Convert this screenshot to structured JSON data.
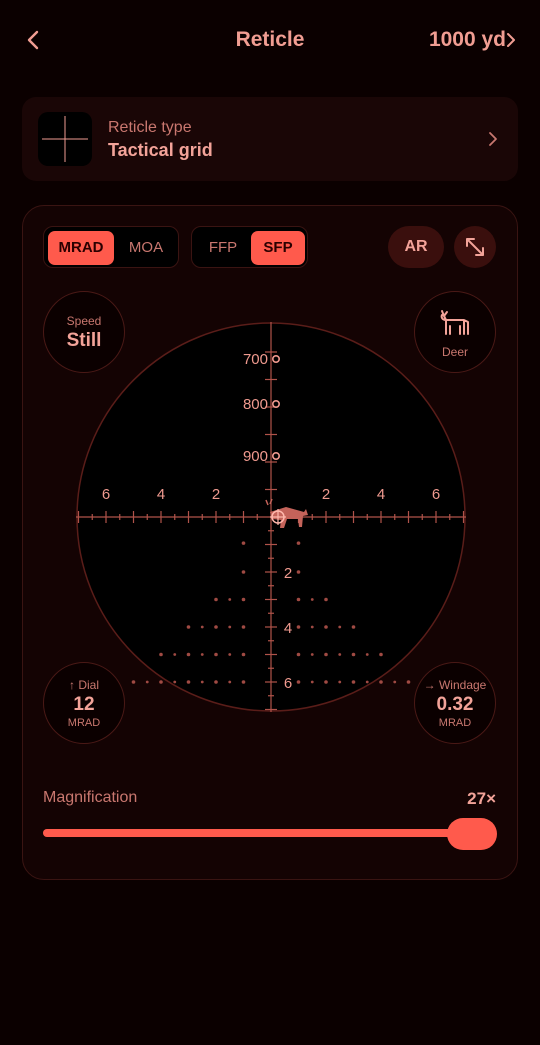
{
  "header": {
    "title": "Reticle",
    "range_label": "1000 yd"
  },
  "reticle_type": {
    "label": "Reticle type",
    "value": "Tactical grid"
  },
  "units": {
    "options": [
      "MRAD",
      "MOA"
    ],
    "selected": "MRAD"
  },
  "plane": {
    "options": [
      "FFP",
      "SFP"
    ],
    "selected": "SFP"
  },
  "ar_label": "AR",
  "speed": {
    "label": "Speed",
    "value": "Still"
  },
  "target": {
    "label": "Deer",
    "icon": "deer-icon"
  },
  "reticle": {
    "holdovers": [
      "700",
      "800",
      "900"
    ],
    "wind_left": [
      "6",
      "4",
      "2"
    ],
    "wind_right": [
      "2",
      "4",
      "6"
    ],
    "drop_labels": [
      "2",
      "4",
      "6"
    ]
  },
  "dial": {
    "label": "Dial",
    "value": "12",
    "unit": "MRAD"
  },
  "windage": {
    "label": "Windage",
    "value": "0.32",
    "unit": "MRAD"
  },
  "magnification": {
    "label": "Magnification",
    "value": "27×",
    "fraction": 0.96
  },
  "colors": {
    "accent": "#ff5a4c",
    "text": "#f3a399",
    "muted": "#c9776f",
    "background": "#0b0000"
  }
}
